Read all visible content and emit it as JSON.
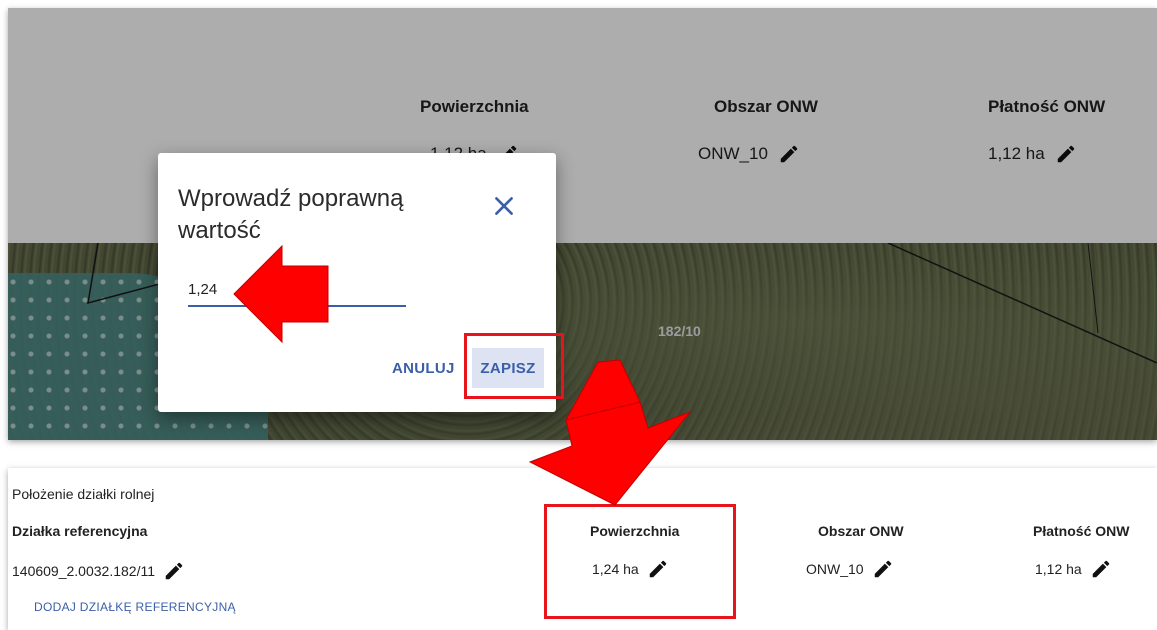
{
  "top": {
    "columns": [
      {
        "header": "Powierzchnia",
        "value": "1,12 ha"
      },
      {
        "header": "Obszar ONW",
        "value": "ONW_10"
      },
      {
        "header": "Płatność ONW",
        "value": "1,12 ha"
      }
    ],
    "map_plot_label": "182/10"
  },
  "dialog": {
    "title": "Wprowadź poprawną wartość",
    "input_value": "1,24",
    "cancel_label": "ANULUJ",
    "save_label": "ZAPISZ"
  },
  "bottom": {
    "section_title": "Położenie działki rolnej",
    "ref_header": "Działka referencyjna",
    "ref_value": "140609_2.0032.182/11",
    "add_ref_link": "DODAJ DZIAŁKĘ REFERENCYJNĄ",
    "columns": [
      {
        "header": "Powierzchnia",
        "value": "1,24 ha"
      },
      {
        "header": "Obszar ONW",
        "value": "ONW_10"
      },
      {
        "header": "Płatność ONW",
        "value": "1,12 ha"
      }
    ]
  },
  "icons": {
    "edit": "pencil-icon",
    "close": "close-icon",
    "annotation": "red-arrow"
  },
  "colors": {
    "accent": "#3a5fa8",
    "highlight": "#e8141b",
    "save_button_bg": "#dde3f2"
  }
}
